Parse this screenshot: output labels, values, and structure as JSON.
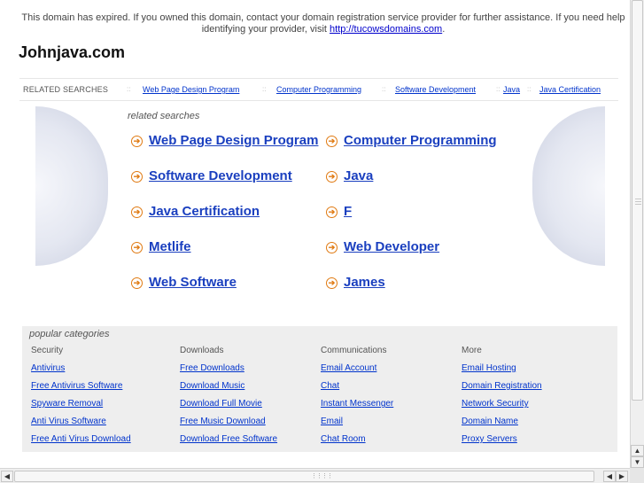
{
  "notice": {
    "text": "This domain has expired. If you owned this domain, contact your domain registration service provider for further assistance. If you need help identifying your provider, visit ",
    "link": "http://tucowsdomains.com",
    "end": "."
  },
  "site_title": "Johnjava.com",
  "related_bar": {
    "label": "RELATED SEARCHES",
    "separator": "::",
    "links": [
      "Web Page Design Program",
      "Computer Programming",
      "Software Development",
      "Java",
      "Java Certification"
    ]
  },
  "related_searches": {
    "heading": "related searches",
    "arrow_icon": "circle-arrow-right-icon",
    "items": [
      "Web Page Design Program",
      "Computer Programming",
      "Software Development",
      "Java",
      "Java Certification",
      "F",
      "Metlife",
      "Web Developer",
      "Web Software",
      "James"
    ]
  },
  "popular": {
    "title": "popular categories",
    "columns": [
      {
        "heading": "Security",
        "links": [
          "Antivirus",
          "Free Antivirus Software",
          "Spyware Removal",
          "Anti Virus Software",
          "Free Anti Virus Download"
        ]
      },
      {
        "heading": "Downloads",
        "links": [
          "Free Downloads",
          "Download Music",
          "Download Full Movie",
          "Free Music Download",
          "Download Free Software"
        ]
      },
      {
        "heading": "Communications",
        "links": [
          "Email Account",
          "Chat",
          "Instant Messenger",
          "Email",
          "Chat Room"
        ]
      },
      {
        "heading": "More",
        "links": [
          "Email Hosting",
          "Domain Registration",
          "Network Security",
          "Domain Name",
          "Proxy Servers"
        ]
      }
    ]
  },
  "colors": {
    "link": "#1a3fbf",
    "arrow": "#e07a12",
    "popular_bg": "#eeeeee"
  },
  "scrollbars": {
    "up_icon": "arrow-up-icon",
    "down_icon": "arrow-down-icon",
    "left_icon": "arrow-left-icon",
    "right_icon": "arrow-right-icon"
  }
}
